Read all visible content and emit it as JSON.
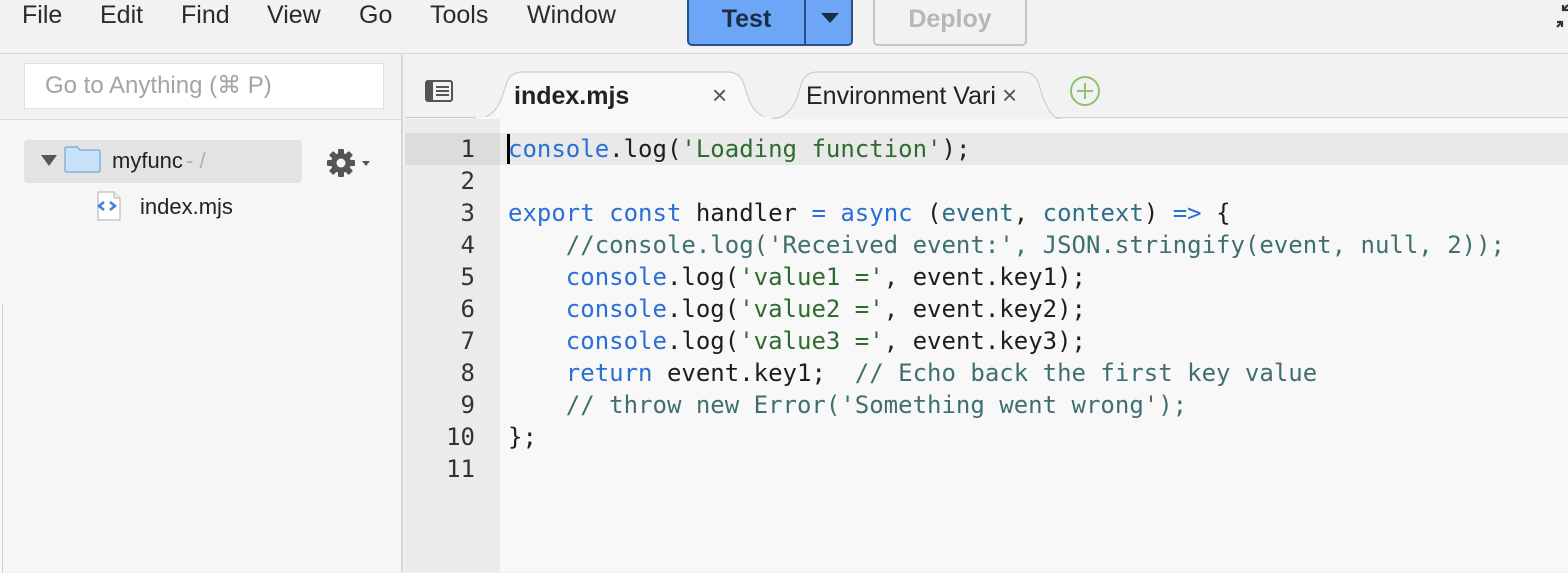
{
  "menubar": {
    "items": [
      {
        "label": "File"
      },
      {
        "label": "Edit"
      },
      {
        "label": "Find"
      },
      {
        "label": "View"
      },
      {
        "label": "Go"
      },
      {
        "label": "Tools"
      },
      {
        "label": "Window"
      }
    ],
    "test_label": "Test",
    "deploy_label": "Deploy"
  },
  "sidebar": {
    "goto_placeholder": "Go to Anything (⌘ P)",
    "folder": {
      "name": "myfunc",
      "path": "- /"
    },
    "file": {
      "name": "index.mjs"
    }
  },
  "tabs": [
    {
      "label": "index.mjs",
      "active": true
    },
    {
      "label": "Environment Vari",
      "active": false
    }
  ],
  "editor": {
    "line_numbers": [
      "1",
      "2",
      "3",
      "4",
      "5",
      "6",
      "7",
      "8",
      "9",
      "10",
      "11"
    ],
    "lines": [
      [
        {
          "t": "obj",
          "v": "console"
        },
        {
          "t": "plain",
          "v": ".log("
        },
        {
          "t": "str",
          "v": "'Loading function'"
        },
        {
          "t": "plain",
          "v": ");"
        }
      ],
      [],
      [
        {
          "t": "kw",
          "v": "export const"
        },
        {
          "t": "plain",
          "v": " handler "
        },
        {
          "t": "kw",
          "v": "="
        },
        {
          "t": "plain",
          "v": " "
        },
        {
          "t": "kw",
          "v": "async"
        },
        {
          "t": "plain",
          "v": " ("
        },
        {
          "t": "param",
          "v": "event"
        },
        {
          "t": "plain",
          "v": ", "
        },
        {
          "t": "param",
          "v": "context"
        },
        {
          "t": "plain",
          "v": ") "
        },
        {
          "t": "kw",
          "v": "=>"
        },
        {
          "t": "plain",
          "v": " {"
        }
      ],
      [
        {
          "t": "plain",
          "v": "    "
        },
        {
          "t": "com",
          "v": "//console.log('Received event:', JSON.stringify(event, null, 2));"
        }
      ],
      [
        {
          "t": "plain",
          "v": "    "
        },
        {
          "t": "obj",
          "v": "console"
        },
        {
          "t": "plain",
          "v": ".log("
        },
        {
          "t": "str",
          "v": "'value1 ='"
        },
        {
          "t": "plain",
          "v": ", event.key1);"
        }
      ],
      [
        {
          "t": "plain",
          "v": "    "
        },
        {
          "t": "obj",
          "v": "console"
        },
        {
          "t": "plain",
          "v": ".log("
        },
        {
          "t": "str",
          "v": "'value2 ='"
        },
        {
          "t": "plain",
          "v": ", event.key2);"
        }
      ],
      [
        {
          "t": "plain",
          "v": "    "
        },
        {
          "t": "obj",
          "v": "console"
        },
        {
          "t": "plain",
          "v": ".log("
        },
        {
          "t": "str",
          "v": "'value3 ='"
        },
        {
          "t": "plain",
          "v": ", event.key3);"
        }
      ],
      [
        {
          "t": "plain",
          "v": "    "
        },
        {
          "t": "kw",
          "v": "return"
        },
        {
          "t": "plain",
          "v": " event.key1;  "
        },
        {
          "t": "com",
          "v": "// Echo back the first key value"
        }
      ],
      [
        {
          "t": "plain",
          "v": "    "
        },
        {
          "t": "com",
          "v": "// throw new Error('Something went wrong');"
        }
      ],
      [
        {
          "t": "plain",
          "v": "};"
        }
      ],
      []
    ]
  },
  "colors": {
    "test_button": "#6da6f7",
    "keyword": "#2b6fd6",
    "string": "#2f6b2f",
    "comment": "#3f6f6f",
    "add_tab": "#8dc26f"
  }
}
